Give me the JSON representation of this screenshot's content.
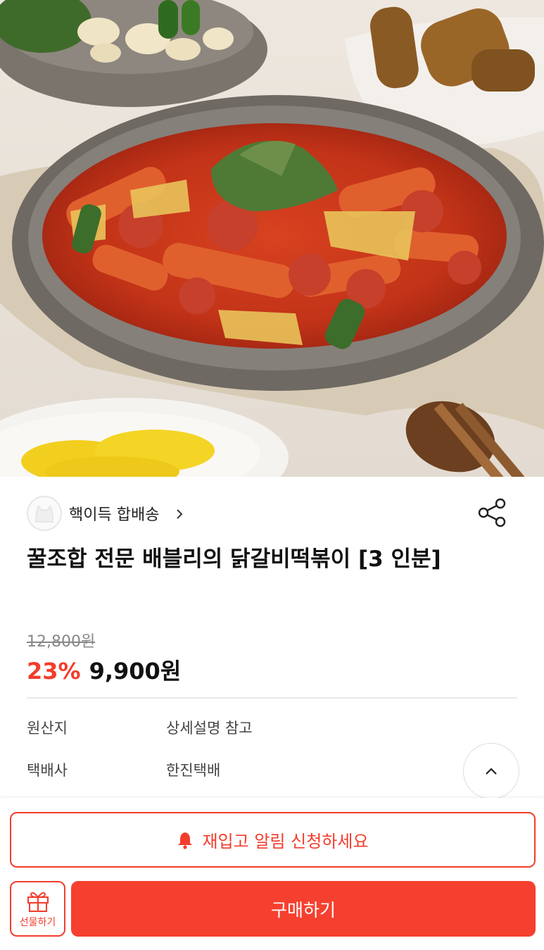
{
  "product_image": {
    "alt": "닭갈비떡볶이"
  },
  "seller": {
    "name": "핵이득 합배송",
    "avatar_icon": "cat-avatar-icon",
    "chevron_icon": "chevron-right-icon"
  },
  "share_icon": "share-icon",
  "product": {
    "title": "꿀조합 전문 배블리의 닭갈비떡볶이 [3 인분]",
    "original_price": "12,800원",
    "discount": "23%",
    "final_price": "9,900원"
  },
  "info": [
    {
      "label": "원산지",
      "value": "상세설명 참고"
    },
    {
      "label": "택배사",
      "value": "한진택배"
    }
  ],
  "scroll_top_icon": "chevron-up-icon",
  "actions": {
    "restock_label": "재입고 알림 신청하세요",
    "restock_icon": "bell-icon",
    "gift_label": "선물하기",
    "gift_icon": "gift-icon",
    "buy_label": "구매하기"
  },
  "colors": {
    "accent": "#f23d2c",
    "buy_button": "#f6402f",
    "text": "#111111",
    "muted": "#888888"
  }
}
